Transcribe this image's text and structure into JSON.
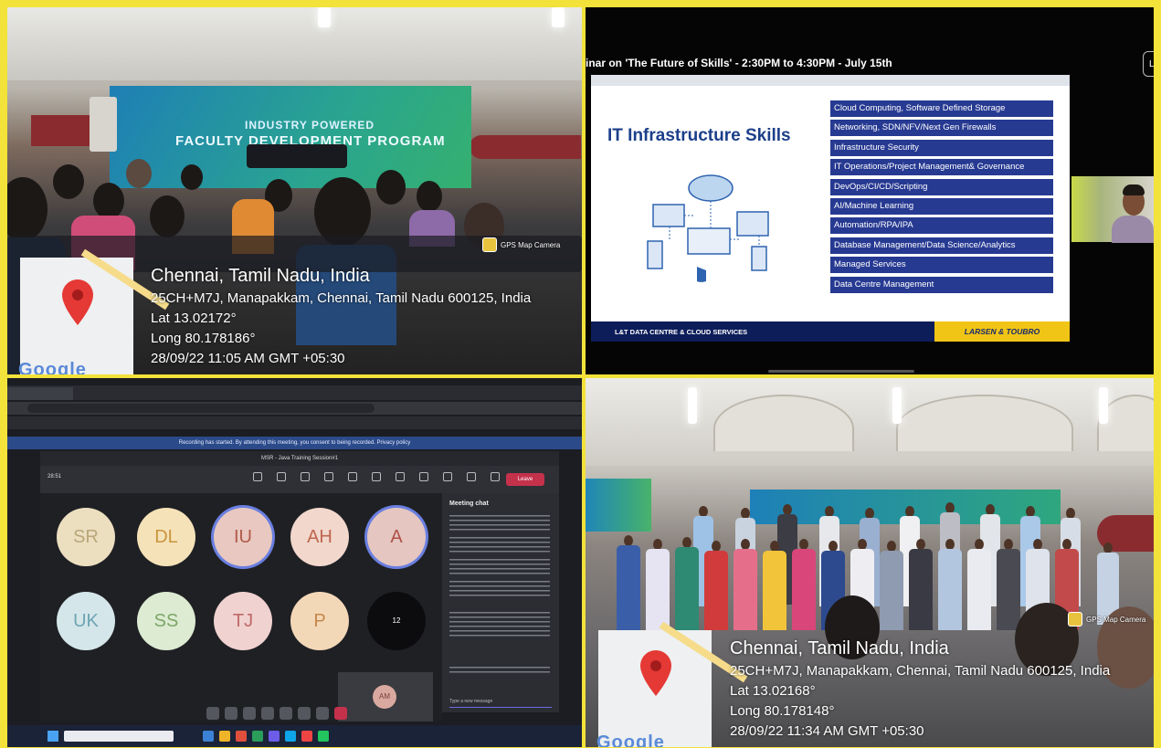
{
  "photo1": {
    "banner_line1": "INDUSTRY POWERED",
    "banner_line2": "FACULTY DEVELOPMENT PROGRAM",
    "badge": "GPS Map Camera",
    "geotag": {
      "place": "Chennai, Tamil Nadu, India",
      "address": "25CH+M7J, Manapakkam, Chennai, Tamil Nadu 600125, India",
      "lat": "Lat 13.02172°",
      "long": "Long 80.178186°",
      "datetime": "28/09/22 11:05 AM GMT +05:30",
      "map_logo": "Google"
    }
  },
  "webinar": {
    "title": "inar on 'The Future of Skills' - 2:30PM to 4:30PM - July 15th",
    "button": "Le",
    "slide_title": "IT Infrastructure Skills",
    "skills": [
      "Cloud Computing, Software Defined Storage",
      "Networking, SDN/NFV/Next Gen Firewalls",
      "Infrastructure Security",
      "IT Operations/Project Management& Governance",
      "DevOps/CI/CD/Scripting",
      "AI/Machine Learning",
      "Automation/RPA/IPA",
      "Database Management/Data Science/Analytics",
      "Managed Services",
      "Data Centre Management"
    ],
    "footer_left": "L&T DATA CENTRE & CLOUD SERVICES",
    "footer_right": "LARSEN & TOUBRO"
  },
  "teams": {
    "window_title": "MSR - Java Training Session#1",
    "recording_banner": "Recording has started. By attending this meeting, you consent to being recorded. Privacy policy",
    "leave": "Leave",
    "timer": "28:51",
    "chat_title": "Meeting chat",
    "chat_input": "Type a new message",
    "participants": [
      {
        "initials": "SR",
        "color": "#ecdfc0",
        "text": "#b9a77a"
      },
      {
        "initials": "DL",
        "color": "#f5e2b8",
        "text": "#c9953e"
      },
      {
        "initials": "IU",
        "color": "#e8c8c0",
        "text": "#b25a4a"
      },
      {
        "initials": "AH",
        "color": "#f1d7cc",
        "text": "#c0664f"
      },
      {
        "initials": "A",
        "color": "#e5c6c0",
        "text": "#b0504a"
      },
      {
        "initials": "UK",
        "color": "#d4e6ea",
        "text": "#6ea5b2"
      },
      {
        "initials": "SS",
        "color": "#dcebd2",
        "text": "#7ea668"
      },
      {
        "initials": "TJ",
        "color": "#f0d2d0",
        "text": "#c06a68"
      },
      {
        "initials": "P",
        "color": "#f3d8b8",
        "text": "#c4874a"
      },
      {
        "initials": "12",
        "color": "#0c0c0e",
        "text": "#ffffff"
      }
    ],
    "self_initials": "AM"
  },
  "photo4": {
    "badge": "GPS Map Camera",
    "geotag": {
      "place": "Chennai, Tamil Nadu, India",
      "address": "25CH+M7J, Manapakkam, Chennai, Tamil Nadu 600125, India",
      "lat": "Lat 13.02168°",
      "long": "Long 80.178148°",
      "datetime": "28/09/22 11:34 AM GMT +05:30",
      "map_logo": "Google"
    }
  },
  "colors": {
    "frame": "#f2e23a",
    "slide_bar": "#273a92",
    "lt_yellow": "#f1c515",
    "teams_leave": "#c4314b"
  }
}
